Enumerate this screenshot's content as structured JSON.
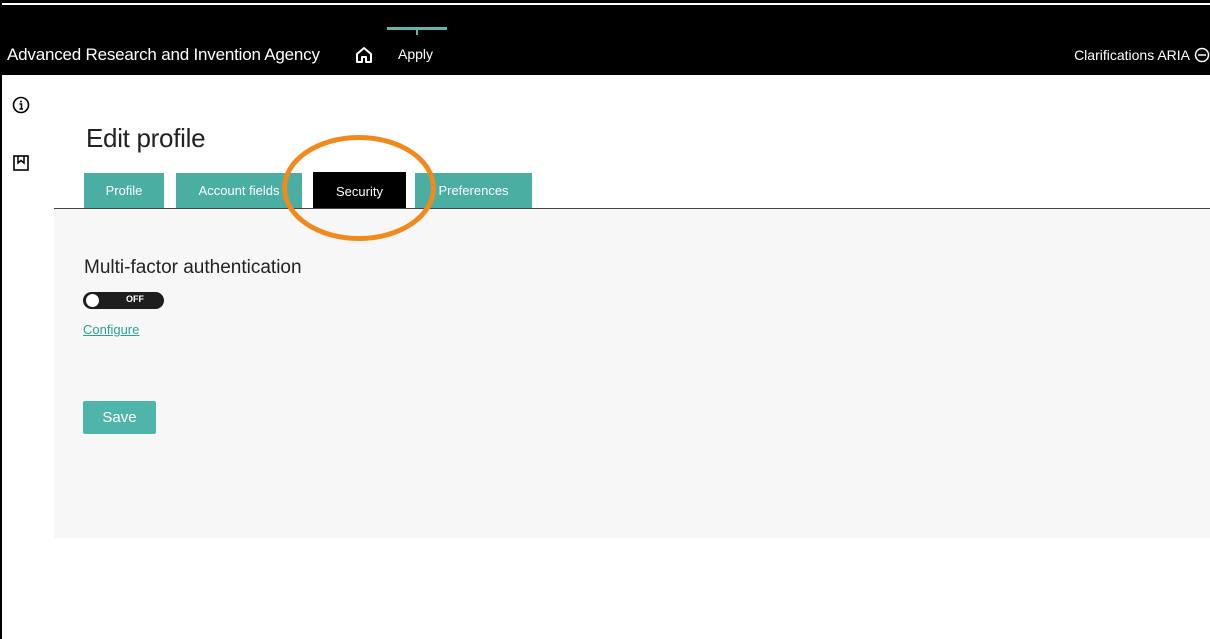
{
  "header": {
    "brand": "Advanced Research and Invention Agency",
    "nav_apply": "Apply",
    "right_label": "Clarifications ARIA",
    "accent_color": "#5cb8ae"
  },
  "sidebar": {
    "icons": [
      "info-icon",
      "bookmark-icon"
    ]
  },
  "page": {
    "title": "Edit profile"
  },
  "tabs": [
    {
      "label": "Profile",
      "active": false
    },
    {
      "label": "Account fields",
      "active": false
    },
    {
      "label": "Security",
      "active": true
    },
    {
      "label": "Preferences",
      "active": false
    }
  ],
  "security": {
    "mfa_title": "Multi-factor authentication",
    "toggle_state": "OFF",
    "configure_link": "Configure",
    "save_label": "Save"
  },
  "annotation": {
    "highlight_color": "#f08a1d"
  }
}
